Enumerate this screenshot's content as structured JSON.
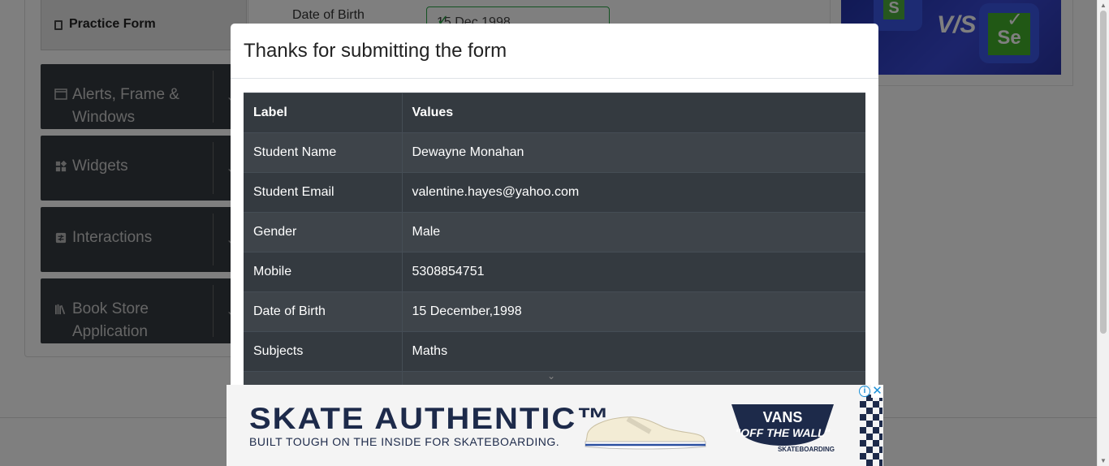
{
  "sidebar": {
    "active_item": {
      "label": "Practice Form",
      "icon": "form-icon"
    },
    "groups": [
      {
        "label": "Alerts, Frame & Windows",
        "icon": "window-icon"
      },
      {
        "label": "Widgets",
        "icon": "widgets-icon"
      },
      {
        "label": "Interactions",
        "icon": "interactions-icon"
      },
      {
        "label": "Book Store Application",
        "icon": "books-icon"
      }
    ]
  },
  "form": {
    "dob_label": "Date of Birth",
    "dob_value": "15 Dec 1998"
  },
  "banner": {
    "left_logo": "S",
    "vs": "V/S",
    "right_logo": "Se"
  },
  "modal": {
    "title": "Thanks for submitting the form",
    "table": {
      "headers": [
        "Label",
        "Values"
      ],
      "rows": [
        [
          "Student Name",
          "Dewayne Monahan"
        ],
        [
          "Student Email",
          "valentine.hayes@yahoo.com"
        ],
        [
          "Gender",
          "Male"
        ],
        [
          "Mobile",
          "5308854751"
        ],
        [
          "Date of Birth",
          "15 December,1998"
        ],
        [
          "Subjects",
          "Maths"
        ]
      ]
    }
  },
  "ad": {
    "headline": "SKATE AUTHENTIC™",
    "subline": "BUILT TOUGH ON THE INSIDE FOR SKATEBOARDING.",
    "brand": "VANS",
    "brand_tagline": "\"OFF THE WALL\"",
    "brand_sub": "SKATEBOARDING"
  }
}
